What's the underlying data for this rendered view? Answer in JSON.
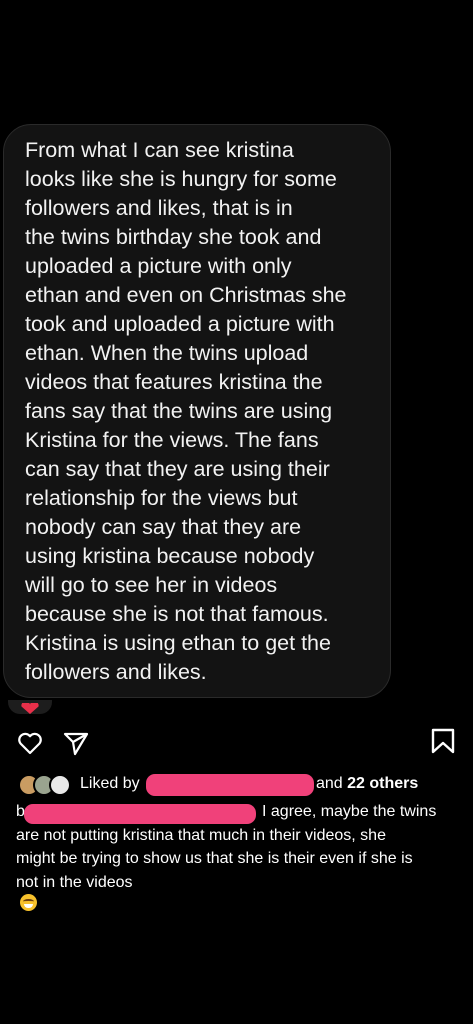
{
  "post": {
    "lines": [
      "From what I can see kristina",
      "looks like she is hungry for some",
      "followers and likes, that is in",
      "the twins birthday she took and",
      "uploaded a picture with only",
      "ethan and even on Christmas she",
      "took and uploaded a picture with",
      "ethan. When the twins upload",
      "videos that features kristina the",
      "fans say that the twins are using",
      "Kristina for the views. The fans",
      "can say that they are using their",
      "relationship for the views but",
      "nobody can say that they are",
      "using kristina because nobody",
      "will go to see her in videos",
      "because she is not that famous.",
      "Kristina is using ethan to get the",
      "followers and likes."
    ]
  },
  "icons": {
    "reaction": "heart-reaction-icon",
    "like": "heart-outline-icon",
    "share": "paper-plane-icon",
    "save": "bookmark-icon"
  },
  "likes": {
    "liked_by_label": "Liked by",
    "and_label": "and",
    "others_label": "22 others"
  },
  "comment": {
    "line1": "I agree, maybe the twins",
    "line2": "are not putting kristina that much in their videos, she",
    "line3": "might be trying to show us that she is their even if she is",
    "line4": "not in the videos",
    "emoji": "grinning-sweat-emoji"
  },
  "colors": {
    "background": "#000000",
    "card": "#131313",
    "redaction": "#f0417a",
    "heart": "#e8304a"
  }
}
